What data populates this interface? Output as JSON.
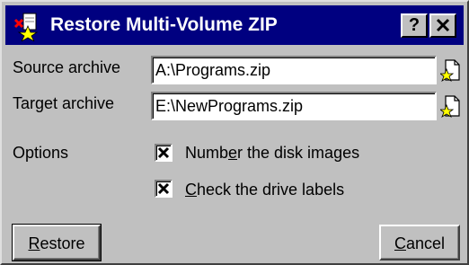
{
  "window": {
    "title": "Restore Multi-Volume ZIP",
    "help_label": "?",
    "close_label": "✕"
  },
  "source": {
    "label": "Source archive",
    "value": "A:\\Programs.zip"
  },
  "target": {
    "label": "Target archive",
    "value": "E:\\NewPrograms.zip"
  },
  "options": {
    "label": "Options",
    "number_images": {
      "pre": "Numb",
      "accel": "e",
      "post": "r the disk images",
      "checked": true
    },
    "check_labels": {
      "pre": "",
      "accel": "C",
      "post": "heck the drive labels",
      "checked": true
    }
  },
  "buttons": {
    "restore": {
      "accel": "R",
      "rest": "estore"
    },
    "cancel": {
      "accel": "C",
      "rest": "ancel"
    }
  },
  "colors": {
    "titlebar": "#000080",
    "face": "#c0c0c0"
  },
  "icons": {
    "app": "restore-zip-icon",
    "browse": "folder-browse-icon"
  }
}
